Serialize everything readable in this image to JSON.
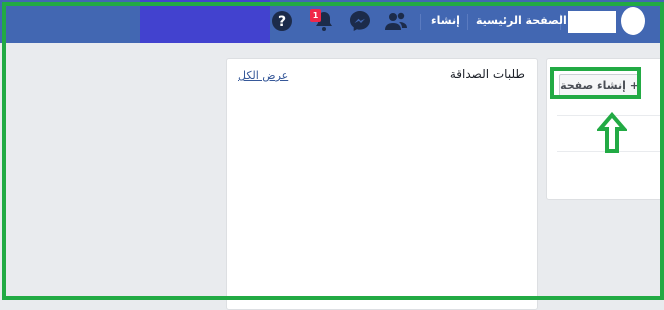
{
  "header": {
    "home_label": "الصفحة الرئيسية",
    "create_label": "إنشاء",
    "notification_count": "1",
    "bar_color": "#4267b2",
    "accent_color": "#4242cf"
  },
  "friend_requests": {
    "title": "طلبات الصداقة",
    "see_all_label": "عرض الكل"
  },
  "pages": {
    "create_page_label": "+ إنشاء صفحة"
  },
  "annotation": {
    "color": "#22aa44"
  },
  "icons": {
    "friends": "friends-icon",
    "messenger": "messenger-icon",
    "notifications": "bell-icon",
    "help": "help-icon"
  }
}
